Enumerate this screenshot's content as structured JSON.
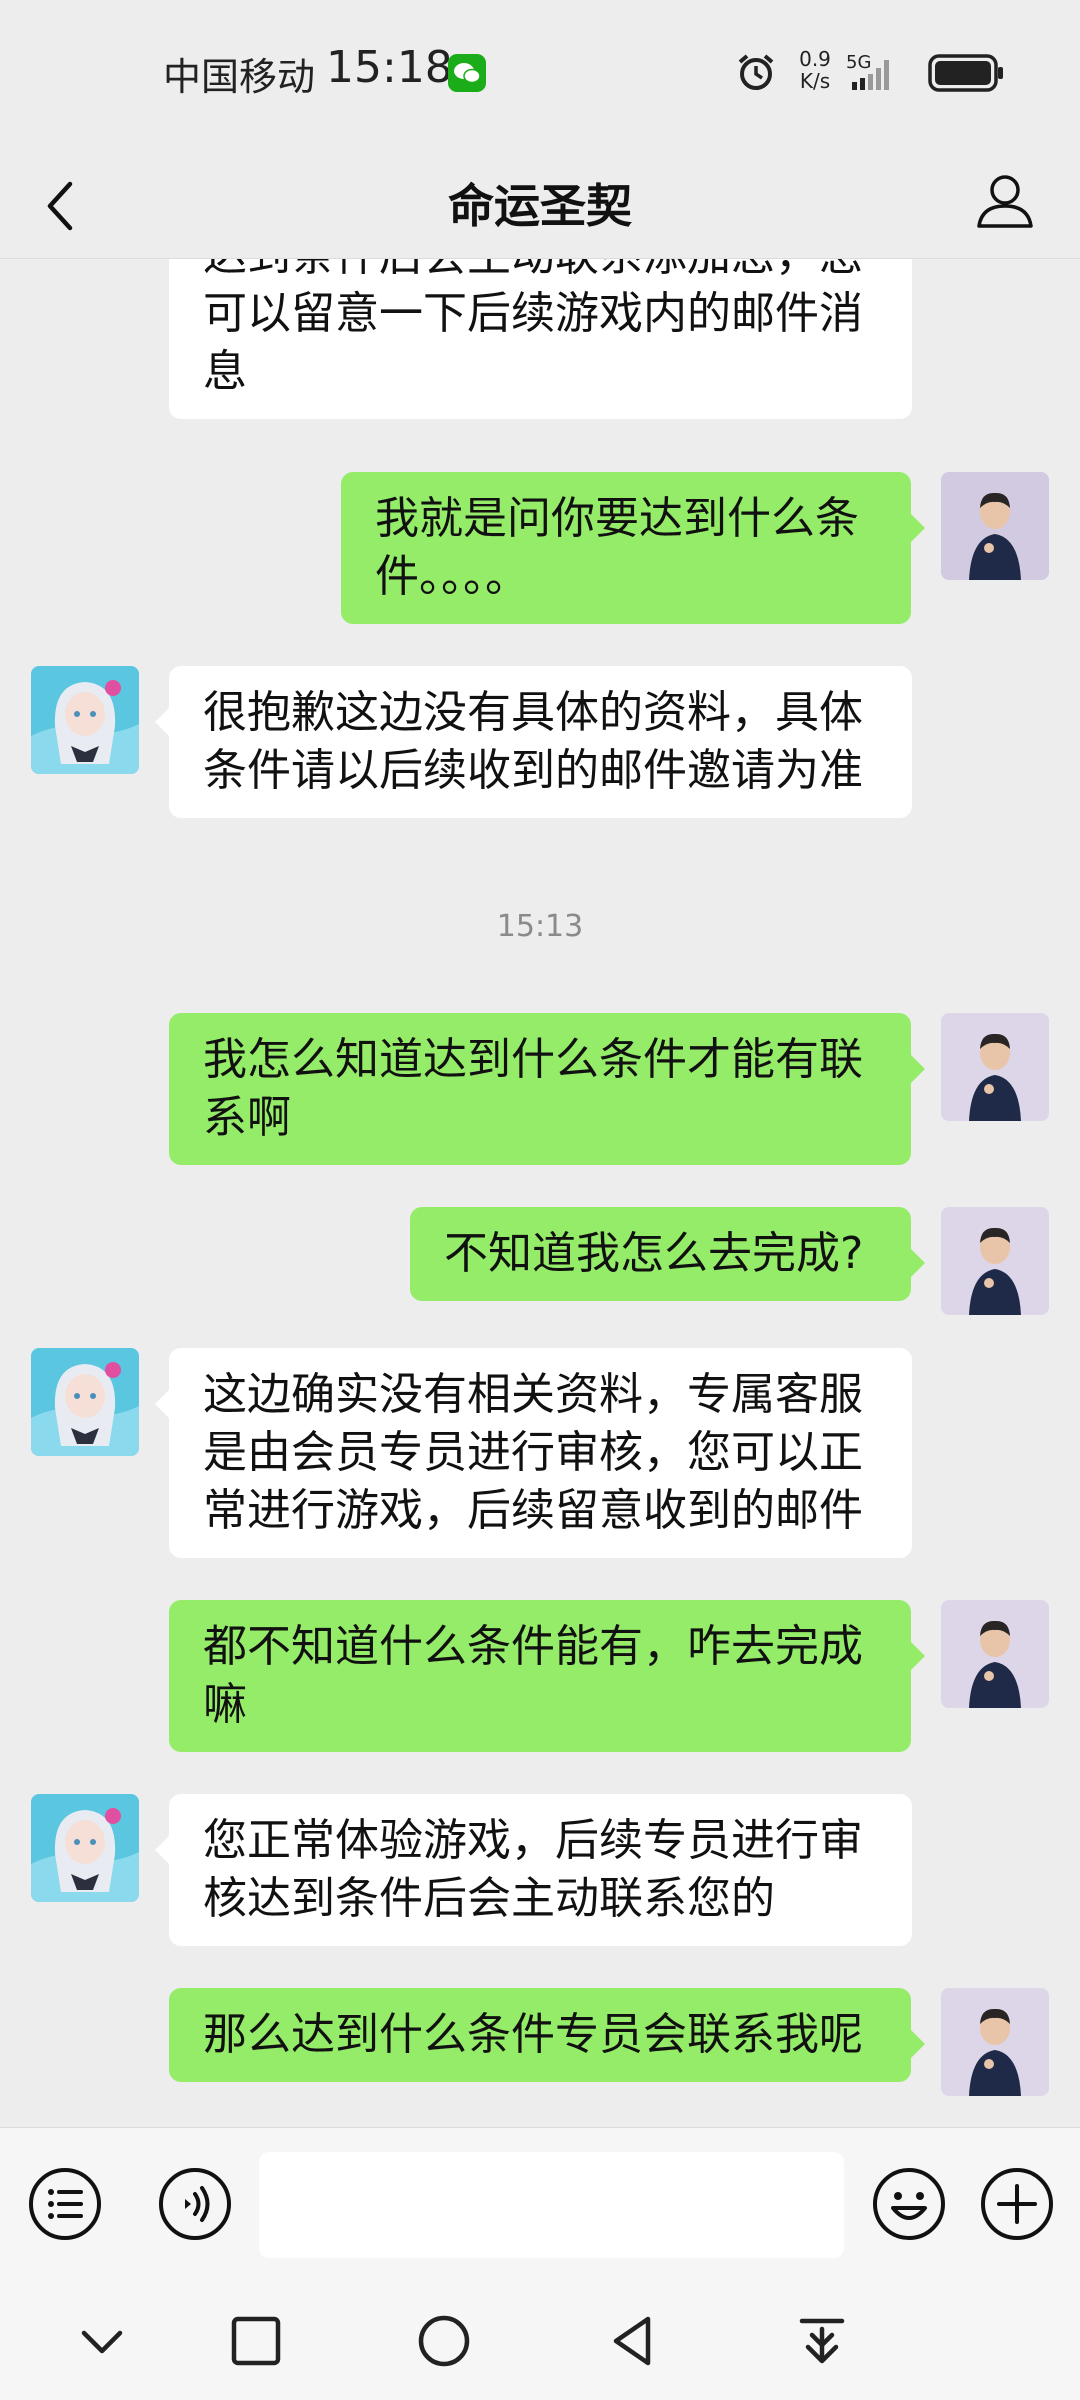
{
  "status_bar": {
    "carrier": "中国移动",
    "time": "15:18",
    "net_speed_value": "0.9",
    "net_speed_unit": "K/s",
    "network": "5G"
  },
  "header": {
    "title": "命运圣契"
  },
  "messages": [
    {
      "side": "in",
      "text": "达到条件后会主动联系添加您，您可以留意一下后续游戏内的邮件消息"
    },
    {
      "side": "out",
      "text": "我就是问你要达到什么条件。。。。"
    },
    {
      "side": "in",
      "text": "很抱歉这边没有具体的资料，具体条件请以后续收到的邮件邀请为准"
    },
    {
      "side": "out",
      "text": "我怎么知道达到什么条件才能有联系啊"
    },
    {
      "side": "out",
      "text": "不知道我怎么去完成?"
    },
    {
      "side": "in",
      "text": "这边确实没有相关资料，专属客服是由会员专员进行审核，您可以正常进行游戏，后续留意收到的邮件"
    },
    {
      "side": "out",
      "text": "都不知道什么条件能有，咋去完成嘛"
    },
    {
      "side": "in",
      "text": "您正常体验游戏，后续专员进行审核达到条件后会主动联系您的"
    },
    {
      "side": "out",
      "text": "那么达到什么条件专员会联系我呢"
    }
  ],
  "timestamp": "15:13",
  "colors": {
    "background": "#ededed",
    "outgoing_bubble": "#95ec69",
    "incoming_bubble": "#ffffff",
    "wechat_green": "#1aad19"
  },
  "icons": {
    "input_bar": [
      "menu-list-icon",
      "voice-icon",
      "emoji-icon",
      "plus-icon"
    ],
    "system_nav": [
      "chevron-down-icon",
      "recents-square-icon",
      "home-circle-icon",
      "back-triangle-icon",
      "download-icon"
    ]
  }
}
